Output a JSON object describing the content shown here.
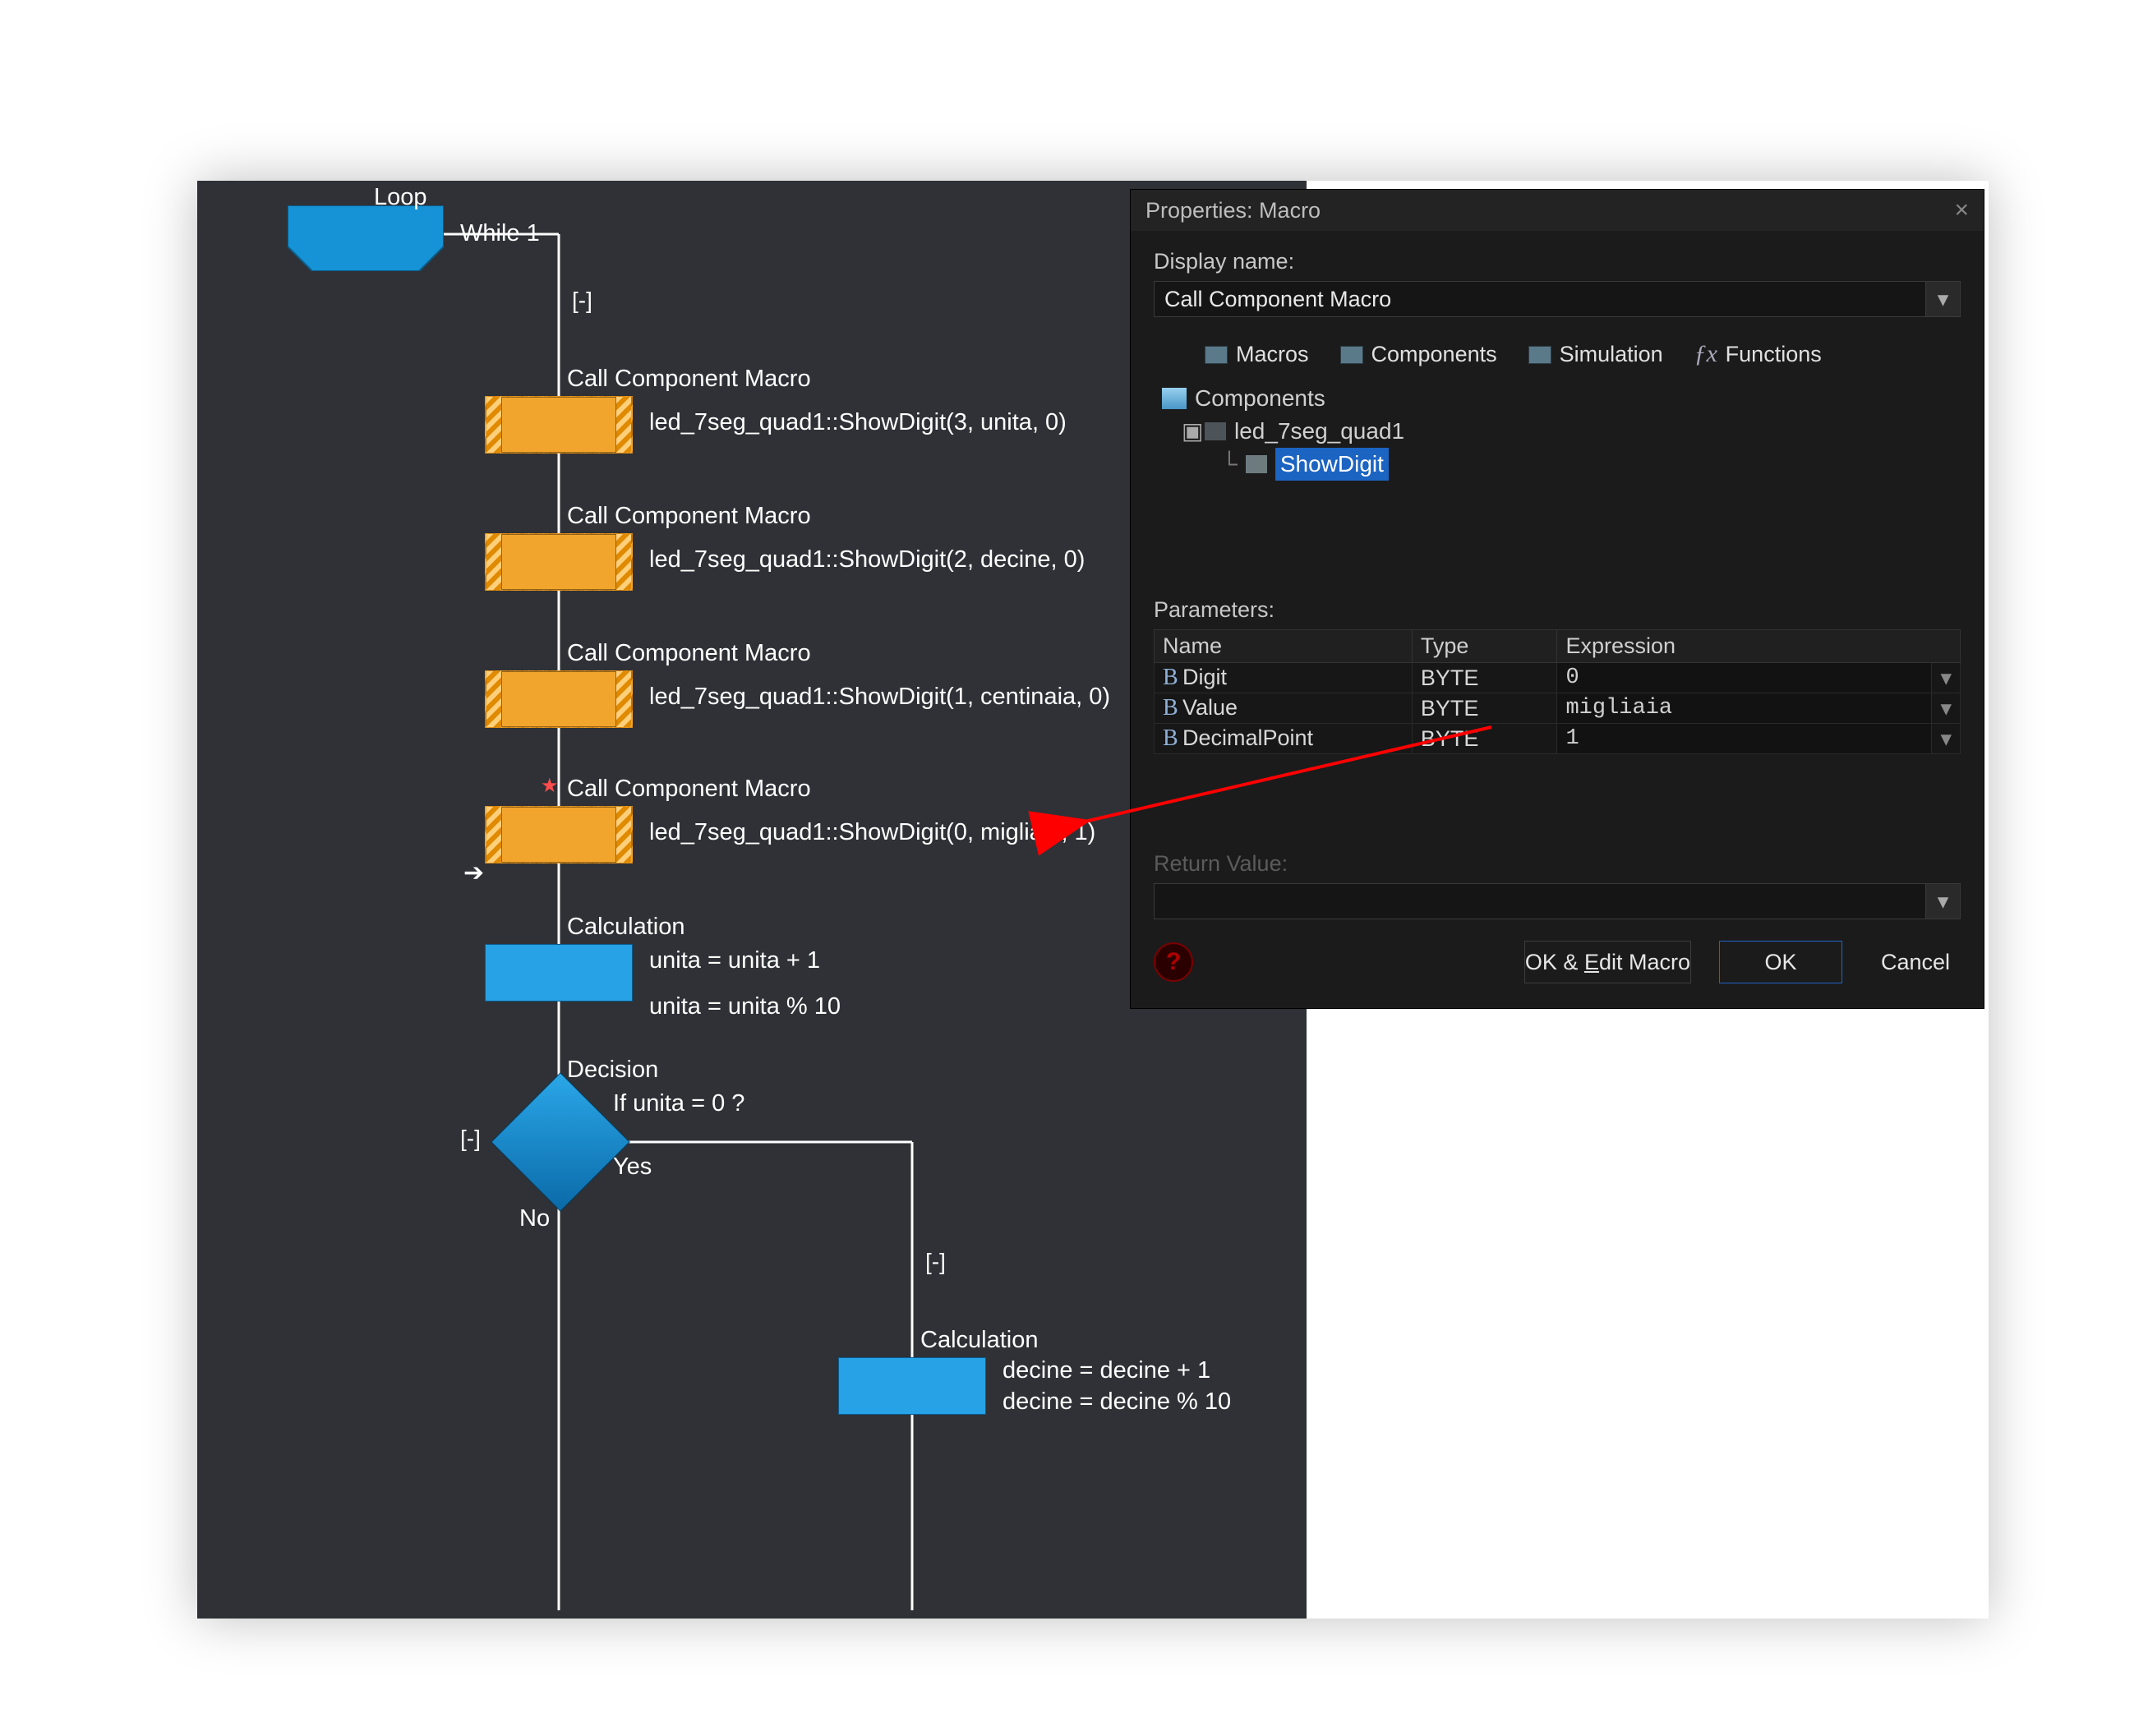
{
  "flow": {
    "loop_label": "Loop",
    "while_cond": "While 1",
    "collapse": "[-]",
    "macro_title": "Call Component Macro",
    "macro1_expr": "led_7seg_quad1::ShowDigit(3, unita, 0)",
    "macro2_expr": "led_7seg_quad1::ShowDigit(2, decine, 0)",
    "macro3_expr": "led_7seg_quad1::ShowDigit(1, centinaia, 0)",
    "macro4_expr": "led_7seg_quad1::ShowDigit(0, migliaia, 1)",
    "calc_label": "Calculation",
    "calc1_line1": "unita = unita + 1",
    "calc1_line2": "unita = unita % 10",
    "decision_label": "Decision",
    "decision_cond": "If  unita = 0 ?",
    "yes": "Yes",
    "no": "No",
    "calc2_line1": "decine = decine + 1",
    "calc2_line2": "decine = decine % 10"
  },
  "dialog": {
    "title": "Properties: Macro",
    "display_name_label": "Display name:",
    "display_name_value": "Call Component Macro",
    "tabs": {
      "macros": "Macros",
      "components": "Components",
      "simulation": "Simulation",
      "functions": "Functions"
    },
    "tree": {
      "root": "Components",
      "node": "led_7seg_quad1",
      "leaf": "ShowDigit"
    },
    "parameters_label": "Parameters:",
    "param_headers": {
      "name": "Name",
      "type": "Type",
      "expr": "Expression"
    },
    "params": [
      {
        "name": "Digit",
        "type": "BYTE",
        "expr": "0"
      },
      {
        "name": "Value",
        "type": "BYTE",
        "expr": "migliaia"
      },
      {
        "name": "DecimalPoint",
        "type": "BYTE",
        "expr": "1"
      }
    ],
    "return_label": "Return Value:",
    "buttons": {
      "ok_edit": "OK & Edit Macro",
      "ok": "OK",
      "cancel": "Cancel"
    }
  }
}
